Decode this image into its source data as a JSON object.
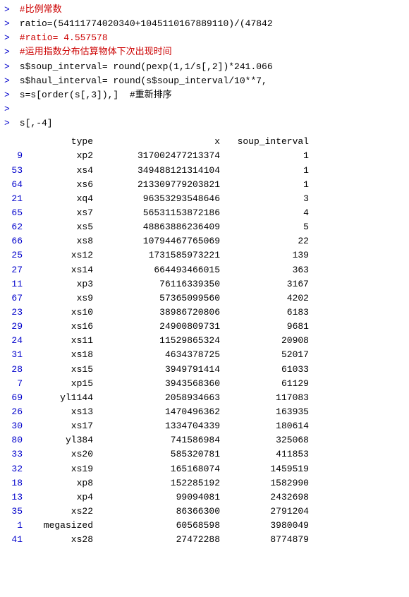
{
  "console": {
    "lines": [
      {
        "prompt": ">",
        "text": " #比例常数",
        "style": "comment"
      },
      {
        "prompt": ">",
        "text": " ratio=(54111774020340+1045110167889110)/(47842",
        "style": "code-black"
      },
      {
        "prompt": ">",
        "text": " #ratio= 4.557578",
        "style": "comment"
      },
      {
        "prompt": ">",
        "text": " #运用指数分布估算物体下次出现时间",
        "style": "comment"
      },
      {
        "prompt": ">",
        "text": " s$soup_interval= round(pexp(1,1/s[,2])*241.066",
        "style": "code-black"
      },
      {
        "prompt": ">",
        "text": " s$haul_interval= round(s$soup_interval/10**7,",
        "style": "code-black"
      },
      {
        "prompt": ">",
        "text": " s=s[order(s[,3]),]  #重新排序",
        "style": "code-black"
      },
      {
        "prompt": ">",
        "text": "",
        "style": "code-black"
      },
      {
        "prompt": ">",
        "text": " s[,-4]",
        "style": "code-black"
      }
    ],
    "table": {
      "headers": [
        "",
        "type",
        "x",
        "soup_interval"
      ],
      "rows": [
        {
          "rownum": "9",
          "type": "xp2",
          "x": "317002477213374",
          "soup_interval": "1"
        },
        {
          "rownum": "53",
          "type": "xs4",
          "x": "349488121314104",
          "soup_interval": "1"
        },
        {
          "rownum": "64",
          "type": "xs6",
          "x": "213309779203821",
          "soup_interval": "1"
        },
        {
          "rownum": "21",
          "type": "xq4",
          "x": "96353293548646",
          "soup_interval": "3"
        },
        {
          "rownum": "65",
          "type": "xs7",
          "x": "56531153872186",
          "soup_interval": "4"
        },
        {
          "rownum": "62",
          "type": "xs5",
          "x": "48863886236409",
          "soup_interval": "5"
        },
        {
          "rownum": "66",
          "type": "xs8",
          "x": "10794467765069",
          "soup_interval": "22"
        },
        {
          "rownum": "25",
          "type": "xs12",
          "x": "1731585973221",
          "soup_interval": "139"
        },
        {
          "rownum": "27",
          "type": "xs14",
          "x": "664493466015",
          "soup_interval": "363"
        },
        {
          "rownum": "11",
          "type": "xp3",
          "x": "76116339350",
          "soup_interval": "3167"
        },
        {
          "rownum": "67",
          "type": "xs9",
          "x": "57365099560",
          "soup_interval": "4202"
        },
        {
          "rownum": "23",
          "type": "xs10",
          "x": "38986720806",
          "soup_interval": "6183"
        },
        {
          "rownum": "29",
          "type": "xs16",
          "x": "24900809731",
          "soup_interval": "9681"
        },
        {
          "rownum": "24",
          "type": "xs11",
          "x": "11529865324",
          "soup_interval": "20908"
        },
        {
          "rownum": "31",
          "type": "xs18",
          "x": "4634378725",
          "soup_interval": "52017"
        },
        {
          "rownum": "28",
          "type": "xs15",
          "x": "3949791414",
          "soup_interval": "61033"
        },
        {
          "rownum": "7",
          "type": "xp15",
          "x": "3943568360",
          "soup_interval": "61129"
        },
        {
          "rownum": "69",
          "type": "yl1144",
          "x": "2058934663",
          "soup_interval": "117083"
        },
        {
          "rownum": "26",
          "type": "xs13",
          "x": "1470496362",
          "soup_interval": "163935"
        },
        {
          "rownum": "30",
          "type": "xs17",
          "x": "1334704339",
          "soup_interval": "180614"
        },
        {
          "rownum": "80",
          "type": "yl384",
          "x": "741586984",
          "soup_interval": "325068"
        },
        {
          "rownum": "33",
          "type": "xs20",
          "x": "585320781",
          "soup_interval": "411853"
        },
        {
          "rownum": "32",
          "type": "xs19",
          "x": "165168074",
          "soup_interval": "1459519"
        },
        {
          "rownum": "18",
          "type": "xp8",
          "x": "152285192",
          "soup_interval": "1582990"
        },
        {
          "rownum": "13",
          "type": "xp4",
          "x": "99094081",
          "soup_interval": "2432698"
        },
        {
          "rownum": "35",
          "type": "xs22",
          "x": "86366300",
          "soup_interval": "2791204"
        },
        {
          "rownum": "1",
          "type": "megasized",
          "x": "60568598",
          "soup_interval": "3980049"
        },
        {
          "rownum": "41",
          "type": "xs28",
          "x": "27472288",
          "soup_interval": "8774879"
        }
      ]
    }
  }
}
